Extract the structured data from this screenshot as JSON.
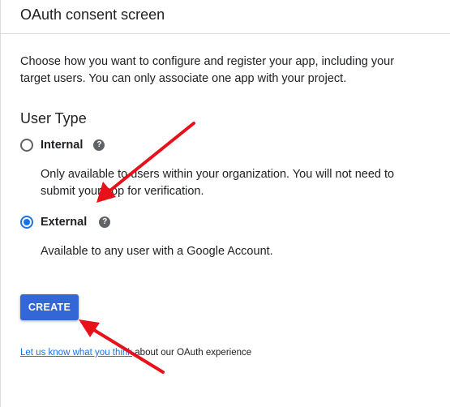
{
  "header": {
    "title": "OAuth consent screen"
  },
  "intro": {
    "text": "Choose how you want to configure and register your app, including your target users. You can only associate one app with your project."
  },
  "user_type": {
    "title": "User Type",
    "options": [
      {
        "label": "Internal",
        "description": "Only available to users within your organization. You will not need to submit your app for verification.",
        "selected": false,
        "help_icon": "help-icon"
      },
      {
        "label": "External",
        "description": "Available to any user with a Google Account.",
        "selected": true,
        "help_icon": "help-icon"
      }
    ]
  },
  "actions": {
    "create_label": "CREATE"
  },
  "feedback": {
    "link_text": "Let us know what you think",
    "suffix": " about our OAuth experience"
  },
  "colors": {
    "accent": "#1a73e8",
    "button": "#3367d6",
    "annotation_arrow": "#e8111a"
  }
}
